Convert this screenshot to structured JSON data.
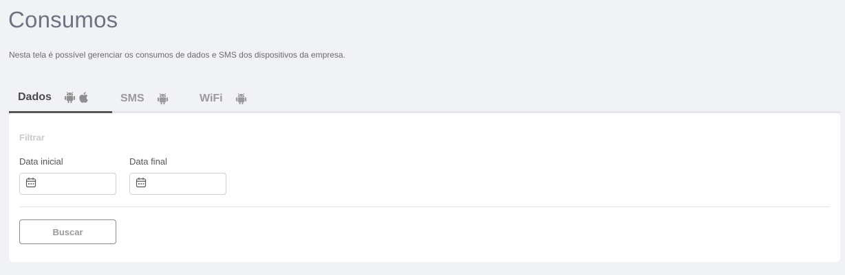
{
  "header": {
    "title": "Consumos",
    "description": "Nesta tela é possível gerenciar os consumos de dados e SMS dos dispositivos da empresa."
  },
  "tabs": [
    {
      "label": "Dados",
      "icons": [
        "android-icon",
        "apple-icon"
      ],
      "active": true
    },
    {
      "label": "SMS",
      "icons": [
        "android-icon"
      ],
      "active": false
    },
    {
      "label": "WiFi",
      "icons": [
        "android-icon"
      ],
      "active": false
    }
  ],
  "filter": {
    "title": "Filtrar",
    "start_date_label": "Data inicial",
    "start_date_value": "",
    "end_date_label": "Data final",
    "end_date_value": "",
    "calendar_icon": "calendar-icon",
    "search_label": "Buscar"
  },
  "colors": {
    "background": "#f1f2f6",
    "card": "#ffffff",
    "active_tab_indicator": "#555555",
    "inactive_text": "#9a9a9a"
  }
}
